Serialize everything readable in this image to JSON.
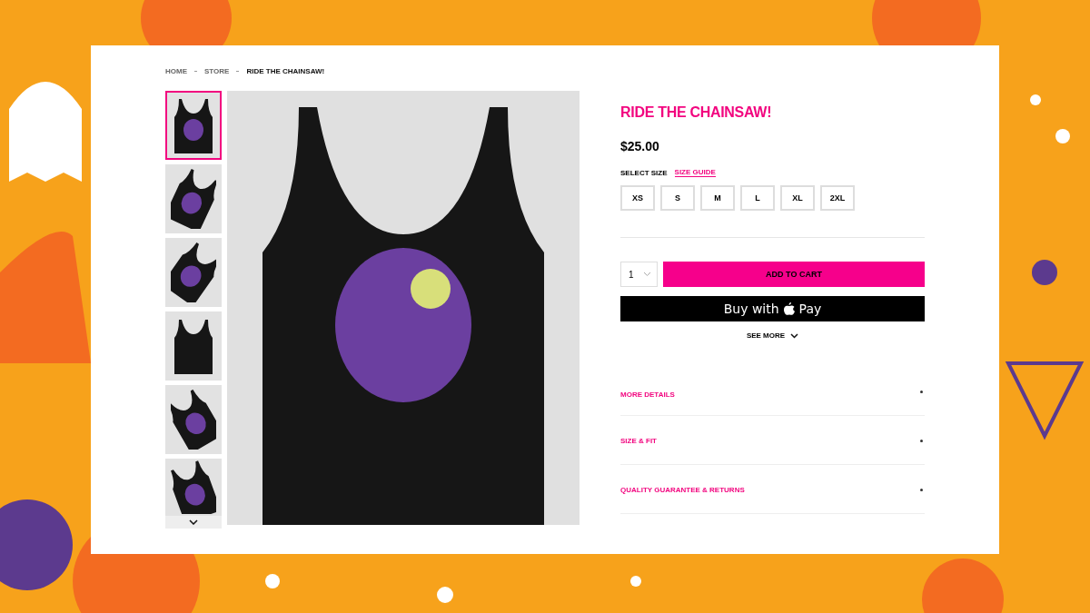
{
  "breadcrumb": [
    {
      "label": "HOME",
      "current": false
    },
    {
      "label": "STORE",
      "current": false
    },
    {
      "label": "RIDE THE CHAINSAW!",
      "current": true
    }
  ],
  "thumbnails": [
    {
      "selected": true
    },
    {
      "selected": false
    },
    {
      "selected": false
    },
    {
      "selected": false
    },
    {
      "selected": false
    },
    {
      "selected": false
    }
  ],
  "product": {
    "title": "RIDE THE CHAINSAW!",
    "price": "$25.00",
    "size_label": "SELECT SIZE",
    "size_guide": "SIZE GUIDE",
    "sizes": [
      {
        "label": "XS",
        "selected": false
      },
      {
        "label": "S",
        "selected": false
      },
      {
        "label": "M",
        "selected": false
      },
      {
        "label": "L",
        "selected": false
      },
      {
        "label": "XL",
        "selected": false
      },
      {
        "label": "2XL",
        "selected": false
      }
    ],
    "quantity": "1",
    "add_to_cart": "ADD TO CART",
    "buy_with": "Buy with",
    "pay": "Pay",
    "see_more": "SEE MORE"
  },
  "accordion": [
    {
      "label": "MORE DETAILS"
    },
    {
      "label": "SIZE & FIT"
    },
    {
      "label": "QUALITY GUARANTEE & RETURNS"
    }
  ]
}
